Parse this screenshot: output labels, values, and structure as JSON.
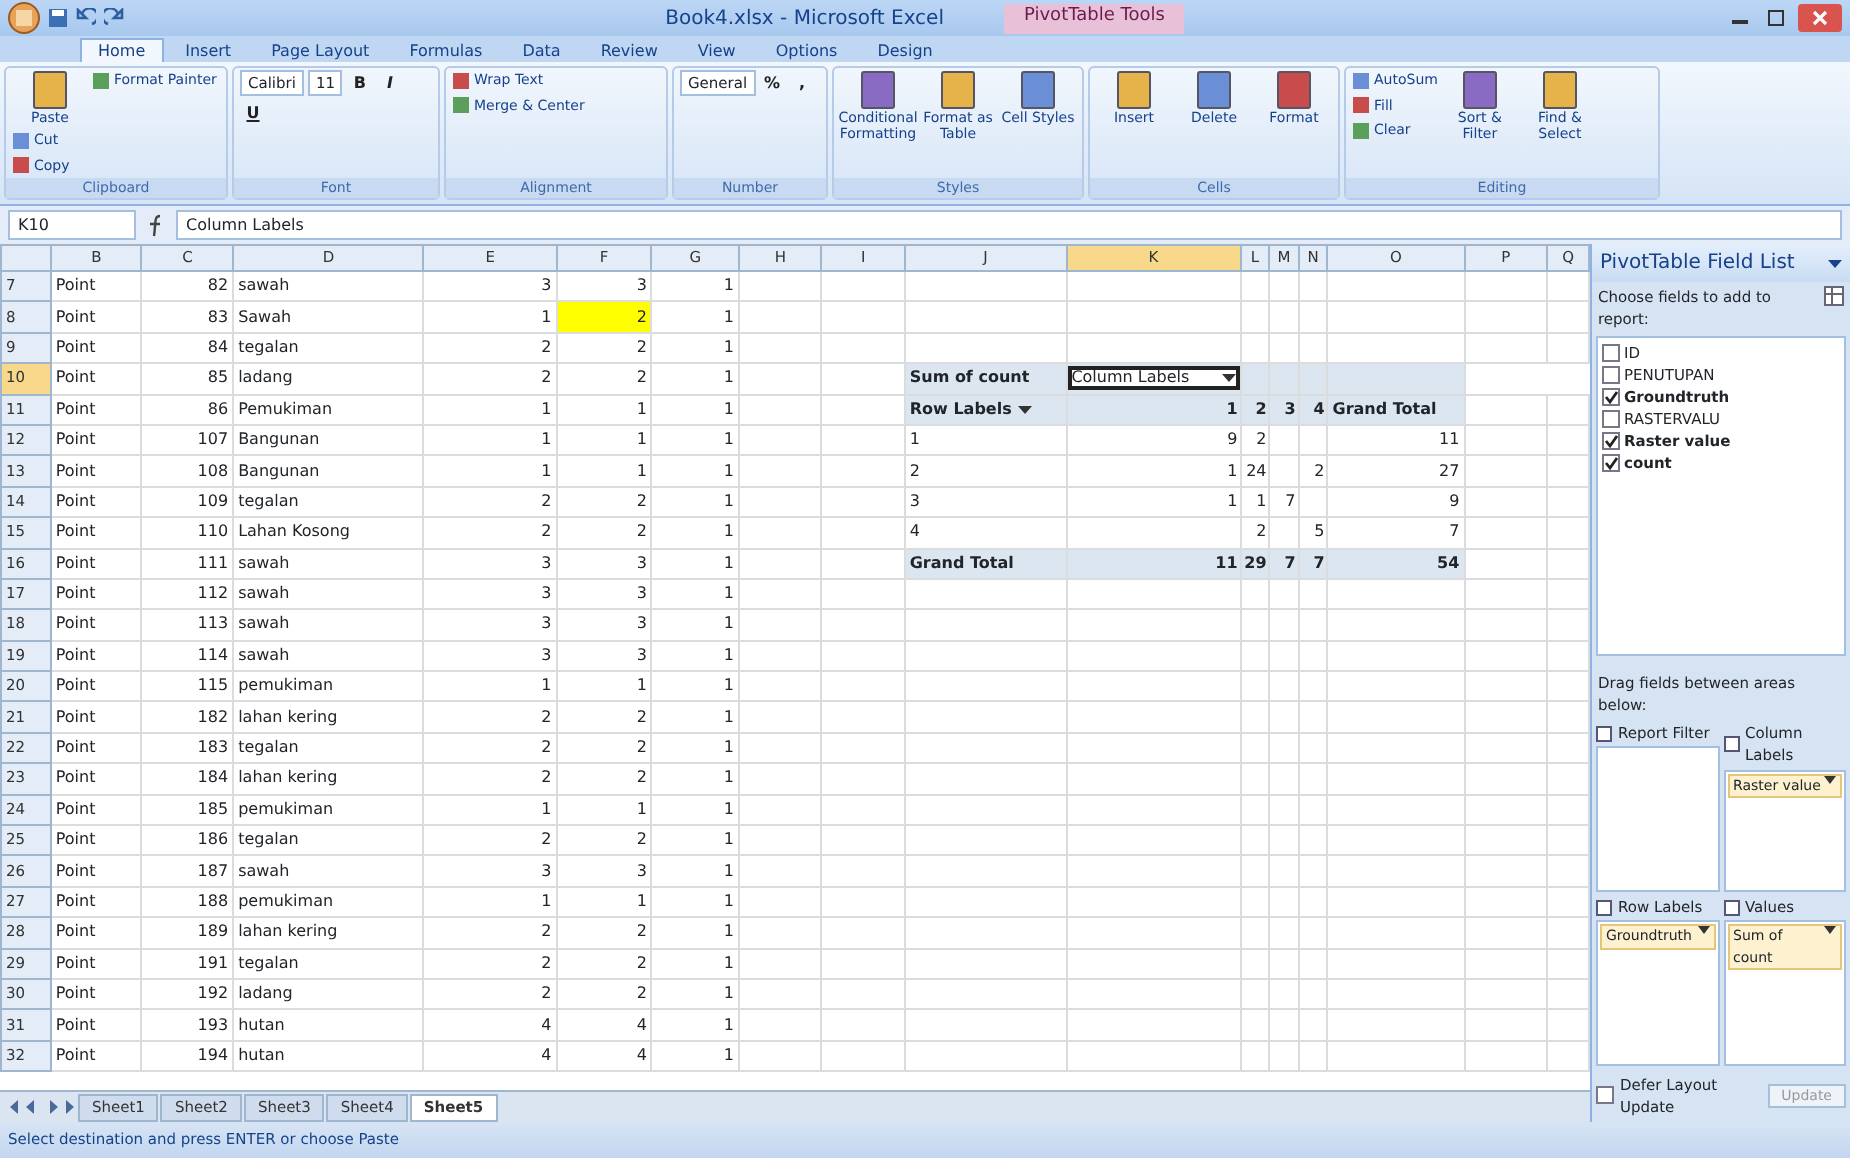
{
  "window": {
    "title": "Book4.xlsx - Microsoft Excel",
    "context_title": "PivotTable Tools"
  },
  "ribbon_tabs": [
    {
      "label": "Home",
      "selected": true
    },
    {
      "label": "Insert",
      "selected": false
    },
    {
      "label": "Page Layout",
      "selected": false
    },
    {
      "label": "Formulas",
      "selected": false
    },
    {
      "label": "Data",
      "selected": false
    },
    {
      "label": "Review",
      "selected": false
    },
    {
      "label": "View",
      "selected": false
    },
    {
      "label": "Options",
      "selected": false
    },
    {
      "label": "Design",
      "selected": false
    }
  ],
  "ribbon_groups": [
    {
      "label": "Clipboard",
      "items": [
        {
          "kind": "large",
          "label": "Paste"
        },
        {
          "kind": "small",
          "label": "Cut"
        },
        {
          "kind": "small",
          "label": "Copy"
        },
        {
          "kind": "small",
          "label": "Format Painter"
        }
      ]
    },
    {
      "label": "Font",
      "items": [
        {
          "kind": "field",
          "label": "Calibri"
        },
        {
          "kind": "field",
          "label": "11"
        },
        {
          "kind": "bold",
          "label": "B"
        },
        {
          "kind": "italic",
          "label": "I"
        },
        {
          "kind": "underline",
          "label": "U"
        }
      ]
    },
    {
      "label": "Alignment",
      "items": [
        {
          "kind": "small",
          "label": "Wrap Text"
        },
        {
          "kind": "small",
          "label": "Merge & Center"
        }
      ]
    },
    {
      "label": "Number",
      "items": [
        {
          "kind": "field",
          "label": "General"
        },
        {
          "kind": "percent",
          "label": "%"
        },
        {
          "kind": "comma",
          "label": ","
        }
      ]
    },
    {
      "label": "Styles",
      "items": [
        {
          "kind": "large",
          "label": "Conditional Formatting"
        },
        {
          "kind": "large",
          "label": "Format as Table"
        },
        {
          "kind": "large",
          "label": "Cell Styles"
        }
      ]
    },
    {
      "label": "Cells",
      "items": [
        {
          "kind": "large",
          "label": "Insert"
        },
        {
          "kind": "large",
          "label": "Delete"
        },
        {
          "kind": "large",
          "label": "Format"
        }
      ]
    },
    {
      "label": "Editing",
      "items": [
        {
          "kind": "small",
          "label": "AutoSum"
        },
        {
          "kind": "small",
          "label": "Fill"
        },
        {
          "kind": "small",
          "label": "Clear"
        },
        {
          "kind": "large",
          "label": "Sort & Filter"
        },
        {
          "kind": "large",
          "label": "Find & Select"
        }
      ]
    }
  ],
  "formula_bar": {
    "name_box": "K10",
    "formula": "Column Labels"
  },
  "columns": [
    {
      "label": "B",
      "selected": false
    },
    {
      "label": "C",
      "selected": false
    },
    {
      "label": "D",
      "selected": false
    },
    {
      "label": "E",
      "selected": false
    },
    {
      "label": "F",
      "selected": false
    },
    {
      "label": "G",
      "selected": false
    },
    {
      "label": "H",
      "selected": false
    },
    {
      "label": "I",
      "selected": false
    },
    {
      "label": "J",
      "selected": false
    },
    {
      "label": "K",
      "selected": true
    },
    {
      "label": "L",
      "selected": false
    },
    {
      "label": "M",
      "selected": false
    },
    {
      "label": "N",
      "selected": false
    },
    {
      "label": "O",
      "selected": false
    },
    {
      "label": "P",
      "selected": false
    },
    {
      "label": "Q",
      "selected": false
    }
  ],
  "rows": [
    {
      "number": "7",
      "selected": false,
      "highlighted": false,
      "cells": [
        "Point",
        "82",
        "sawah",
        "3",
        "3",
        "1"
      ]
    },
    {
      "number": "8",
      "selected": false,
      "highlighted": true,
      "cells": [
        "Point",
        "83",
        "Sawah",
        "1",
        "2",
        "1"
      ]
    },
    {
      "number": "9",
      "selected": false,
      "highlighted": false,
      "cells": [
        "Point",
        "84",
        "tegalan",
        "2",
        "2",
        "1"
      ]
    },
    {
      "number": "10",
      "selected": true,
      "highlighted": false,
      "cells": [
        "Point",
        "85",
        "ladang",
        "2",
        "2",
        "1"
      ],
      "pivot": {
        "kind": "filter",
        "label": "Sum of count",
        "field": {
          "label": "Column Labels",
          "selected": true
        }
      }
    },
    {
      "number": "11",
      "selected": false,
      "highlighted": false,
      "cells": [
        "Point",
        "86",
        "Pemukiman",
        "1",
        "1",
        "1"
      ],
      "pivot": {
        "kind": "header",
        "label": "Row Labels",
        "values": {
          "col_1": "1",
          "col_2": "2",
          "col_3": "3",
          "col_4": "4"
        },
        "total": "Grand Total"
      }
    },
    {
      "number": "12",
      "selected": false,
      "highlighted": false,
      "cells": [
        "Point",
        "107",
        "Bangunan",
        "1",
        "1",
        "1"
      ],
      "pivot": {
        "kind": "data",
        "label": "1",
        "values": {
          "col_1": "9",
          "col_2": "2"
        },
        "total": "11"
      }
    },
    {
      "number": "13",
      "selected": false,
      "highlighted": false,
      "cells": [
        "Point",
        "108",
        "Bangunan",
        "1",
        "1",
        "1"
      ],
      "pivot": {
        "kind": "data",
        "label": "2",
        "values": {
          "col_1": "1",
          "col_2": "24",
          "col_4": "2"
        },
        "total": "27"
      }
    },
    {
      "number": "14",
      "selected": false,
      "highlighted": false,
      "cells": [
        "Point",
        "109",
        "tegalan",
        "2",
        "2",
        "1"
      ],
      "pivot": {
        "kind": "data",
        "label": "3",
        "values": {
          "col_1": "1",
          "col_2": "1",
          "col_3": "7"
        },
        "total": "9"
      }
    },
    {
      "number": "15",
      "selected": false,
      "highlighted": false,
      "cells": [
        "Point",
        "110",
        "Lahan Kosong",
        "2",
        "2",
        "1"
      ],
      "pivot": {
        "kind": "data",
        "label": "4",
        "values": {
          "col_2": "2",
          "col_4": "5"
        },
        "total": "7"
      }
    },
    {
      "number": "16",
      "selected": false,
      "highlighted": false,
      "cells": [
        "Point",
        "111",
        "sawah",
        "3",
        "3",
        "1"
      ],
      "pivot": {
        "kind": "total",
        "label": "Grand Total",
        "values": {
          "col_1": "11",
          "col_2": "29",
          "col_3": "7",
          "col_4": "7"
        },
        "total": "54"
      }
    },
    {
      "number": "17",
      "selected": false,
      "highlighted": false,
      "cells": [
        "Point",
        "112",
        "sawah",
        "3",
        "3",
        "1"
      ]
    },
    {
      "number": "18",
      "selected": false,
      "highlighted": false,
      "cells": [
        "Point",
        "113",
        "sawah",
        "3",
        "3",
        "1"
      ]
    },
    {
      "number": "19",
      "selected": false,
      "highlighted": false,
      "cells": [
        "Point",
        "114",
        "sawah",
        "3",
        "3",
        "1"
      ]
    },
    {
      "number": "20",
      "selected": false,
      "highlighted": false,
      "cells": [
        "Point",
        "115",
        "pemukiman",
        "1",
        "1",
        "1"
      ]
    },
    {
      "number": "21",
      "selected": false,
      "highlighted": false,
      "cells": [
        "Point",
        "182",
        "lahan kering",
        "2",
        "2",
        "1"
      ]
    },
    {
      "number": "22",
      "selected": false,
      "highlighted": false,
      "cells": [
        "Point",
        "183",
        "tegalan",
        "2",
        "2",
        "1"
      ]
    },
    {
      "number": "23",
      "selected": false,
      "highlighted": false,
      "cells": [
        "Point",
        "184",
        "lahan kering",
        "2",
        "2",
        "1"
      ]
    },
    {
      "number": "24",
      "selected": false,
      "highlighted": false,
      "cells": [
        "Point",
        "185",
        "pemukiman",
        "1",
        "1",
        "1"
      ]
    },
    {
      "number": "25",
      "selected": false,
      "highlighted": false,
      "cells": [
        "Point",
        "186",
        "tegalan",
        "2",
        "2",
        "1"
      ]
    },
    {
      "number": "26",
      "selected": false,
      "highlighted": false,
      "cells": [
        "Point",
        "187",
        "sawah",
        "3",
        "3",
        "1"
      ]
    },
    {
      "number": "27",
      "selected": false,
      "highlighted": false,
      "cells": [
        "Point",
        "188",
        "pemukiman",
        "1",
        "1",
        "1"
      ]
    },
    {
      "number": "28",
      "selected": false,
      "highlighted": false,
      "cells": [
        "Point",
        "189",
        "lahan kering",
        "2",
        "2",
        "1"
      ]
    },
    {
      "number": "29",
      "selected": false,
      "highlighted": false,
      "cells": [
        "Point",
        "191",
        "tegalan",
        "2",
        "2",
        "1"
      ]
    },
    {
      "number": "30",
      "selected": false,
      "highlighted": false,
      "cells": [
        "Point",
        "192",
        "ladang",
        "2",
        "2",
        "1"
      ]
    },
    {
      "number": "31",
      "selected": false,
      "highlighted": false,
      "cells": [
        "Point",
        "193",
        "hutan",
        "4",
        "4",
        "1"
      ]
    },
    {
      "number": "32",
      "selected": false,
      "highlighted": false,
      "cells": [
        "Point",
        "194",
        "hutan",
        "4",
        "4",
        "1"
      ]
    }
  ],
  "sheet_tabs": [
    {
      "label": "Sheet1",
      "selected": false
    },
    {
      "label": "Sheet2",
      "selected": false
    },
    {
      "label": "Sheet3",
      "selected": false
    },
    {
      "label": "Sheet4",
      "selected": false
    },
    {
      "label": "Sheet5",
      "selected": true
    }
  ],
  "field_list": {
    "title": "PivotTable Field List",
    "choose_label": "Choose fields to add to report:",
    "fields": [
      {
        "label": "ID",
        "checked": false
      },
      {
        "label": "PENUTUPAN",
        "checked": false
      },
      {
        "label": "Groundtruth",
        "checked": true
      },
      {
        "label": "RASTERVALU",
        "checked": false
      },
      {
        "label": "Raster value",
        "checked": true
      },
      {
        "label": "count",
        "checked": true
      }
    ],
    "drag_label": "Drag fields between areas below:",
    "areas": [
      {
        "label": "Report Filter"
      },
      {
        "label": "Column Labels",
        "items": [
          "Raster value"
        ]
      },
      {
        "label": "Row Labels",
        "items": [
          "Groundtruth"
        ]
      },
      {
        "label": "Values",
        "items": [
          "Sum of count"
        ]
      }
    ],
    "defer": {
      "label": "Defer Layout Update",
      "checked": false
    },
    "update": {
      "label": "Update",
      "disabled": true
    }
  },
  "status_bar": {
    "text": "Select destination and press ENTER or choose Paste"
  }
}
